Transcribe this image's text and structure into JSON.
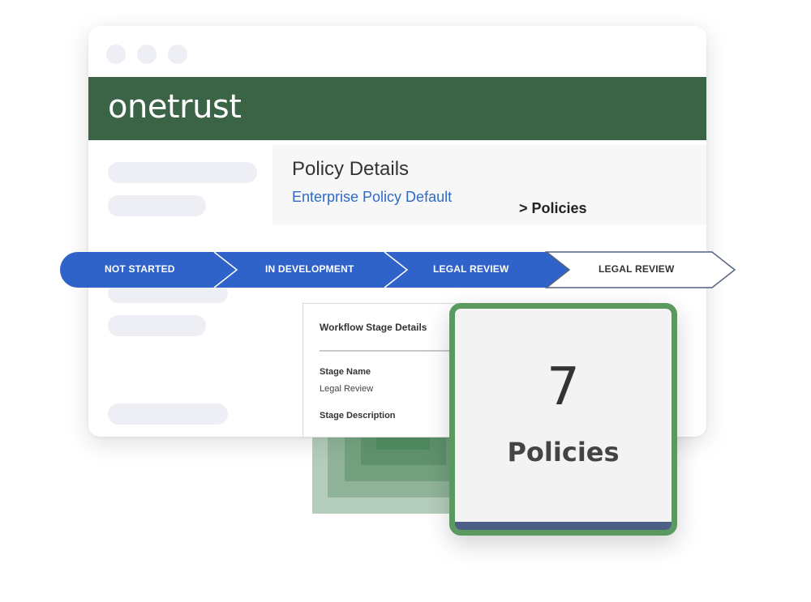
{
  "brand": {
    "logo_text": "onetrust",
    "color": "#3b6446"
  },
  "policy": {
    "title": "Policy Details",
    "subtitle": "Enterprise Policy Default",
    "crumb": "> Policies"
  },
  "workflow": {
    "stages": [
      {
        "label": "NOT STARTED",
        "state": "complete"
      },
      {
        "label": "IN DEVELOPMENT",
        "state": "complete"
      },
      {
        "label": "LEGAL REVIEW",
        "state": "complete"
      },
      {
        "label": "LEGAL REVIEW",
        "state": "pending"
      }
    ],
    "active_color": "#2f63c9"
  },
  "stage_details": {
    "title": "Workflow Stage Details",
    "name_label": "Stage Name",
    "name_value": "Legal Review",
    "description_label": "Stage Description"
  },
  "summary": {
    "count": "7",
    "label": "Policies",
    "border_color": "#5a9a61"
  }
}
